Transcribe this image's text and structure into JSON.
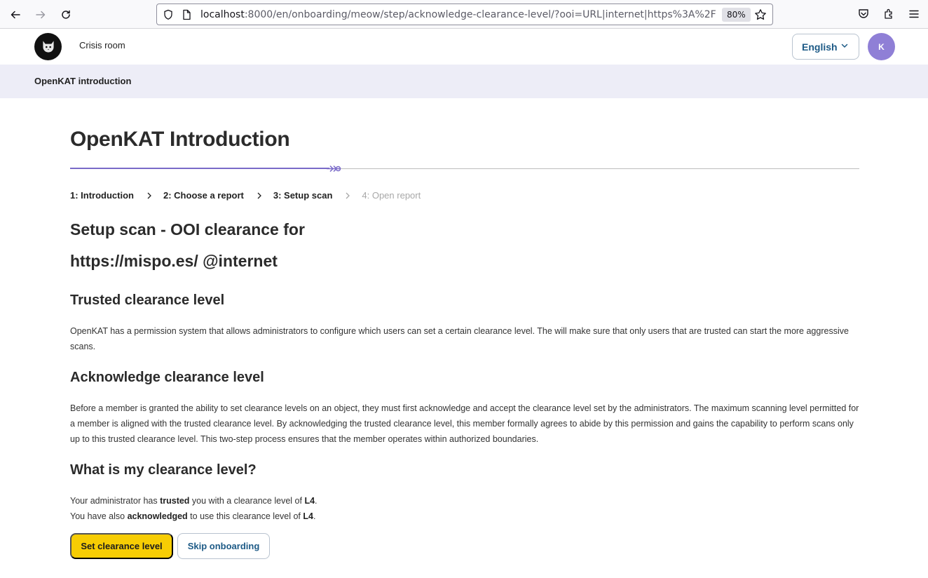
{
  "browser": {
    "url_host": "localhost",
    "url_rest": ":8000/en/onboarding/meow/step/acknowledge-clearance-level/?ooi=URL|internet|https%3A%2F",
    "zoom": "80%"
  },
  "header": {
    "crisis_room": "Crisis room",
    "language": "English",
    "avatar_initial": "K",
    "subnav_title": "OpenKAT introduction"
  },
  "main": {
    "title": "OpenKAT Introduction",
    "progress_fraction": 0.33,
    "steps": [
      {
        "label": "1: Introduction",
        "active": true
      },
      {
        "label": "2: Choose a report",
        "active": true
      },
      {
        "label": "3: Setup scan",
        "active": true
      },
      {
        "label": "4: Open report",
        "active": false
      }
    ],
    "heading_line1": "Setup scan - OOI clearance for",
    "heading_line2": "https://mispo.es/ @internet",
    "trusted": {
      "title": "Trusted clearance level",
      "text": "OpenKAT has a permission system that allows administrators to configure which users can set a certain clearance level. The will make sure that only users that are trusted can start the more aggressive scans."
    },
    "acknowledge": {
      "title": "Acknowledge clearance level",
      "text": "Before a member is granted the ability to set clearance levels on an object, they must first acknowledge and accept the clearance level set by the administrators. The maximum scanning level permitted for a member is aligned with the trusted clearance level. By acknowledging the trusted clearance level, this member formally agrees to abide by this permission and gains the capability to perform scans only up to this trusted clearance level. This two-step process ensures that the member operates within authorized boundaries."
    },
    "my_level": {
      "title": "What is my clearance level?",
      "line1_pre": "Your administrator has ",
      "line1_bold": "trusted",
      "line1_mid": " you with a clearance level of ",
      "line1_level": "L4",
      "line1_end": ".",
      "line2_pre": "You have also ",
      "line2_bold": "acknowledged",
      "line2_mid": " to use this clearance level of ",
      "line2_level": "L4",
      "line2_end": "."
    },
    "buttons": {
      "primary": "Set clearance level",
      "secondary": "Skip onboarding"
    }
  },
  "colors": {
    "accent": "#7a6ac8",
    "primary_button": "#f7cd04",
    "link": "#1d5a86",
    "avatar": "#8f7fd6",
    "subnav_bg": "#ededf7"
  }
}
